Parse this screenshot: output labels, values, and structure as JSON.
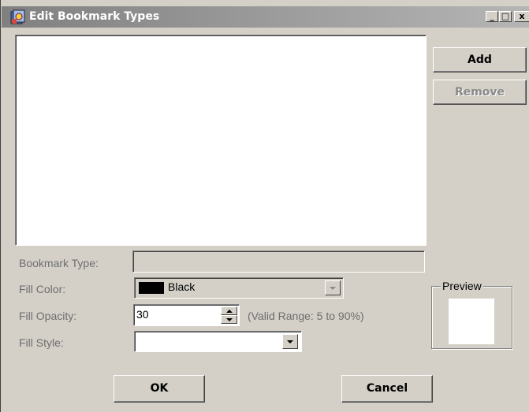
{
  "window": {
    "title": "Edit Bookmark Types",
    "icon": "bookmark-app-icon",
    "caption_buttons": {
      "minimize": "_",
      "maximize": "□",
      "close": "x"
    }
  },
  "buttons": {
    "add": "Add",
    "remove": "Remove",
    "ok": "OK",
    "cancel": "Cancel"
  },
  "form": {
    "bookmark_type": {
      "label": "Bookmark Type:",
      "value": ""
    },
    "fill_color": {
      "label": "Fill Color:",
      "value": "Black",
      "swatch": "#000000"
    },
    "fill_opacity": {
      "label": "Fill Opacity:",
      "value": "30",
      "hint": "(Valid Range: 5 to 90%)"
    },
    "fill_style": {
      "label": "Fill Style:",
      "value": ""
    }
  },
  "preview": {
    "label": "Preview",
    "color": "#ffffff"
  },
  "colors": {
    "dialog_bg": "#d4d0c8",
    "titlebar_start": "#808080",
    "titlebar_end": "#b5b5b5",
    "disabled_text": "#8a8a8a"
  }
}
